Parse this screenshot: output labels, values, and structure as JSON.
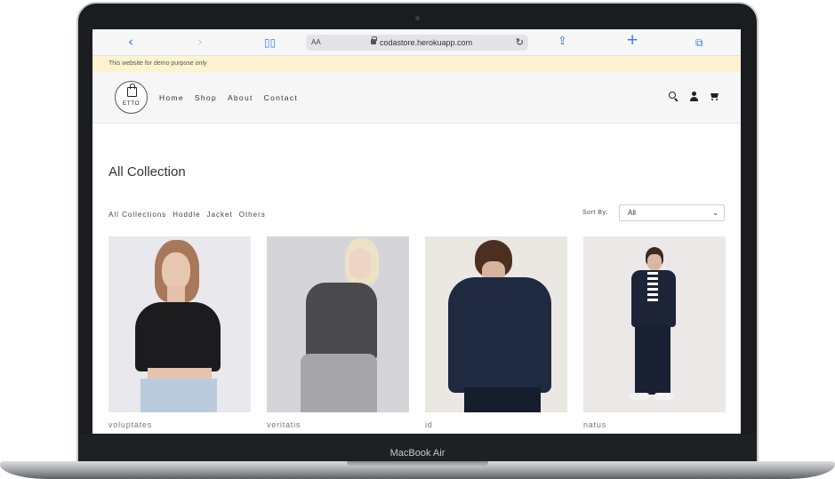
{
  "device": {
    "label": "MacBook Air"
  },
  "browser": {
    "address_prefix": "AA",
    "url": "codastore.herokuapp.com"
  },
  "banner": {
    "text": "This website for demo purpose only"
  },
  "header": {
    "logo_text": "ETTO",
    "nav": [
      "Home",
      "Shop",
      "About",
      "Contact"
    ]
  },
  "page": {
    "title": "All Collection",
    "filters": [
      "All Collections",
      "Hoddle",
      "Jacket",
      "Others"
    ],
    "sort": {
      "label": "Sort By:",
      "value": "All"
    }
  },
  "products": [
    {
      "name": "voluptates"
    },
    {
      "name": "veritatis"
    },
    {
      "name": "id"
    },
    {
      "name": "natus"
    }
  ],
  "colors": {
    "banner": "#fdf3d0",
    "link_blue": "#2f7bf5",
    "header_bg": "#f6f6f6"
  }
}
